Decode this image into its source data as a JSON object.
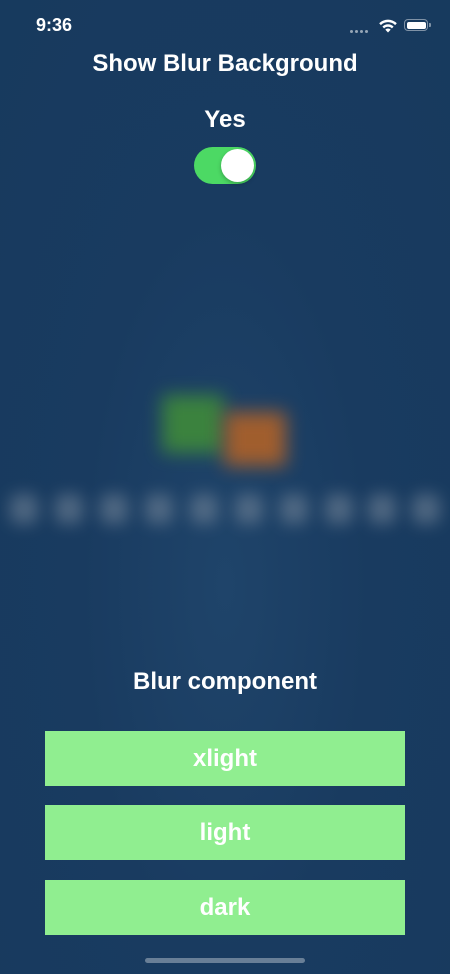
{
  "status_bar": {
    "time": "9:36"
  },
  "header": {
    "title": "Show Blur Background",
    "toggle_label": "Yes",
    "toggle_on": true
  },
  "section": {
    "title": "Blur component"
  },
  "buttons": [
    {
      "label": "xlight"
    },
    {
      "label": "light"
    },
    {
      "label": "dark"
    }
  ],
  "colors": {
    "background": "#183a5e",
    "toggle_on": "#4cd964",
    "button_bg": "#90ee90",
    "text": "#ffffff"
  }
}
